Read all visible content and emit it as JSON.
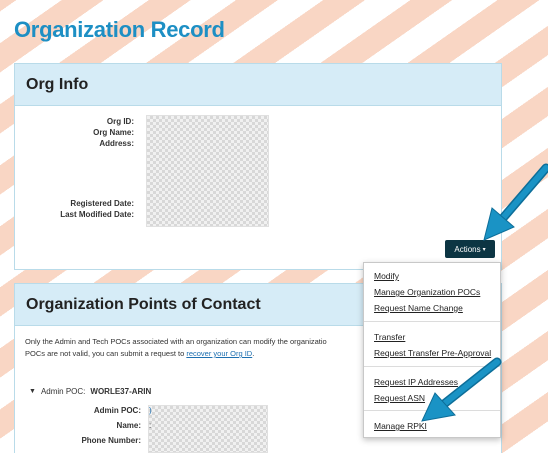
{
  "page": {
    "title": "Organization Record"
  },
  "org_info": {
    "header": "Org Info",
    "labels": [
      "Org ID:",
      "Org Name:",
      "Address:",
      "Registered Date:",
      "Last Modified Date:"
    ],
    "actions_label": "Actions",
    "actions_caret": "▾"
  },
  "dropdown": {
    "items": [
      "Modify",
      "Manage Organization POCs",
      "Request Name Change",
      "Transfer",
      "Request Transfer Pre-Approval",
      "Request IP Addresses",
      "Request ASN",
      "Manage RPKI"
    ]
  },
  "poc": {
    "header": "Organization Points of Contact",
    "desc_line1": "Only the Admin and Tech POCs associated with an organization can modify the organizatio",
    "desc_line2_prefix": "POCs are not valid, you can submit a request to ",
    "desc_link": "recover your Org ID",
    "desc_line2_suffix": ".",
    "toggle_label": "Admin POC:",
    "toggle_value": "WORLE37-ARIN",
    "fields": [
      "Admin POC:",
      "Name:",
      "Phone Number:"
    ],
    "admin_poc_fragment": ")",
    "name_fragment": ":"
  },
  "colors": {
    "title": "#1d8fc4",
    "header_bg": "#d6ecf7",
    "actions_bg": "#0c3543",
    "arrow": "#1a93c5",
    "stripe": "#f9d6c4"
  }
}
